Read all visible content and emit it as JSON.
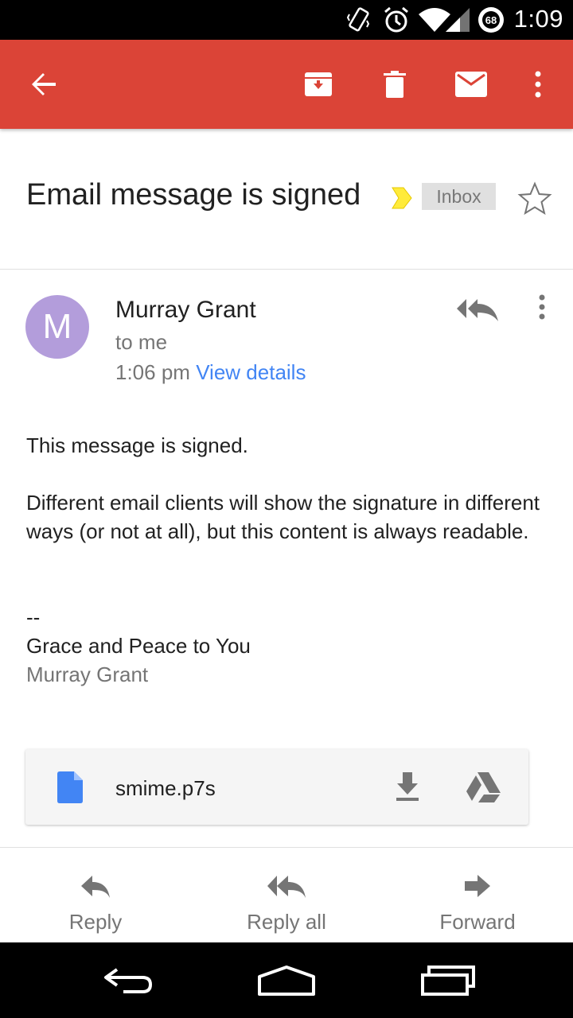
{
  "status_bar": {
    "time": "1:09",
    "battery": "68",
    "icons": [
      "vibrate-icon",
      "alarm-icon",
      "wifi-icon",
      "signal-icon",
      "battery-icon"
    ]
  },
  "toolbar": {
    "background": "#db4437",
    "icons": [
      "back-arrow-icon",
      "archive-icon",
      "delete-icon",
      "mark-unread-icon",
      "more-vert-icon"
    ]
  },
  "message": {
    "subject": "Email message is signed",
    "label": "Inbox",
    "sender": {
      "initial": "M",
      "name": "Murray Grant",
      "to": "to me",
      "time": "1:06 pm",
      "view_details": "View details"
    },
    "body": {
      "line1": "This message is signed.",
      "paragraph2": "Different email clients will show the signature in different ways (or not at all), but this content is always readable.",
      "sig_separator": "--",
      "sig_line": "Grace and Peace to You",
      "sig_name": "Murray Grant"
    },
    "attachment": {
      "name": "smime.p7s"
    }
  },
  "actions": {
    "reply": "Reply",
    "reply_all": "Reply all",
    "forward": "Forward"
  },
  "colors": {
    "accent": "#db4437",
    "link": "#4285f4",
    "avatar": "#b39ddb",
    "label_marker": "#ffeb3b"
  }
}
